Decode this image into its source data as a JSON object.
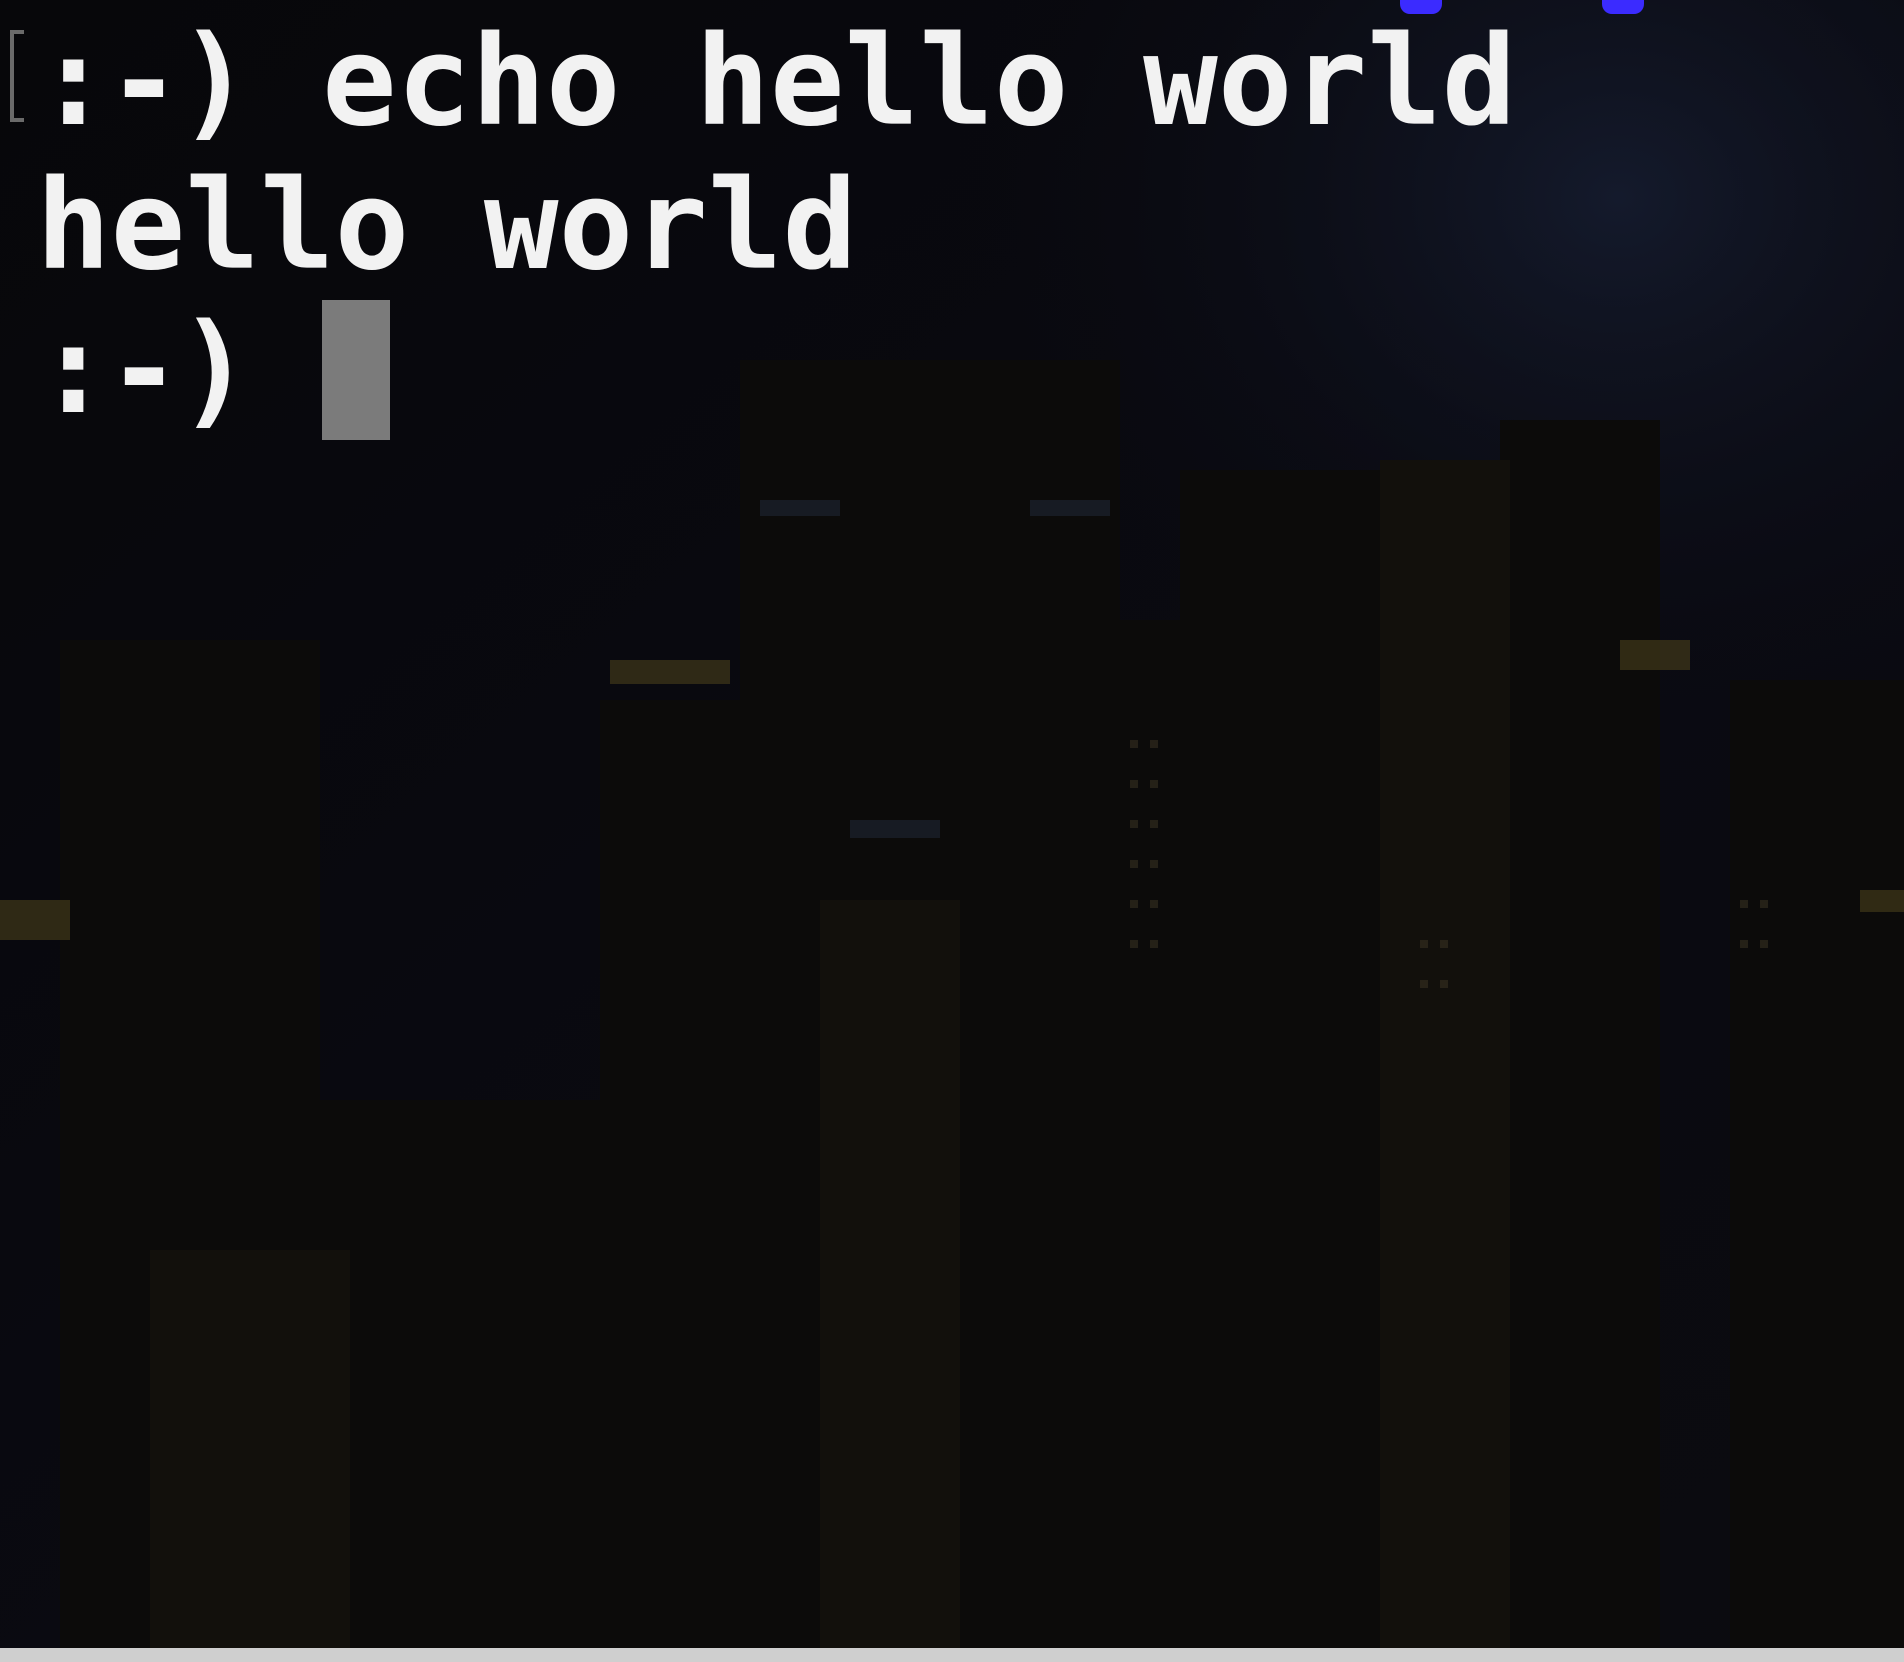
{
  "terminal": {
    "lines": [
      {
        "prompt": ":-)",
        "command": "echo hello world"
      },
      {
        "output": "hello world"
      },
      {
        "prompt": ":-)",
        "command": ""
      }
    ],
    "colors": {
      "text": "#f2f2f2",
      "cursor": "#7b7b7b",
      "background": "#050507",
      "accent_fragment": "#3b2bff"
    },
    "background_image": "city-night-wallpaper"
  }
}
